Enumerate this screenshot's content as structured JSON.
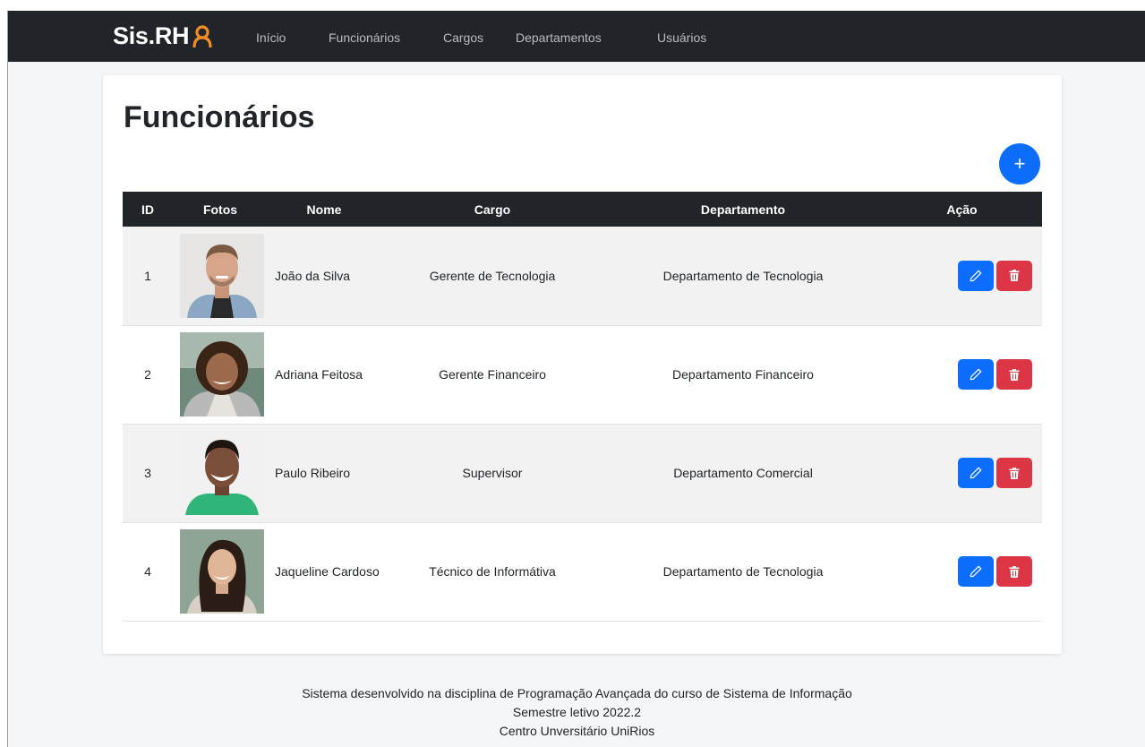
{
  "brand": {
    "text": "Sis.RH"
  },
  "nav": {
    "items": [
      {
        "label": "Início"
      },
      {
        "label": "Funcionários"
      },
      {
        "label": "Cargos"
      },
      {
        "label": "Departamentos"
      },
      {
        "label": "Usuários"
      }
    ]
  },
  "page": {
    "title": "Funcionários",
    "add_label": "+"
  },
  "table": {
    "headers": [
      "ID",
      "Fotos",
      "Nome",
      "Cargo",
      "Departamento",
      "Ação"
    ],
    "rows": [
      {
        "id": "1",
        "name": "João da Silva",
        "cargo": "Gerente de Tecnologia",
        "departamento": "Departamento de Tecnologia"
      },
      {
        "id": "2",
        "name": "Adriana Feitosa",
        "cargo": "Gerente Financeiro",
        "departamento": "Departamento Financeiro"
      },
      {
        "id": "3",
        "name": "Paulo Ribeiro",
        "cargo": "Supervisor",
        "departamento": "Departamento Comercial"
      },
      {
        "id": "4",
        "name": "Jaqueline Cardoso",
        "cargo": "Técnico de Informátiva",
        "departamento": "Departamento de Tecnologia"
      }
    ]
  },
  "footer": {
    "line1": "Sistema desenvolvido na disciplina de Programação Avançada do curso de Sistema de Informação",
    "line2": "Semestre letivo 2022.2",
    "line3": "Centro Unversitário UniRios"
  },
  "colors": {
    "navbar": "#212529",
    "brand_accent": "#f28c28",
    "primary": "#0d6efd",
    "danger": "#dc3545"
  },
  "icons": {
    "brand": "person-outline-icon",
    "edit": "pencil-icon",
    "delete": "trash-icon"
  }
}
